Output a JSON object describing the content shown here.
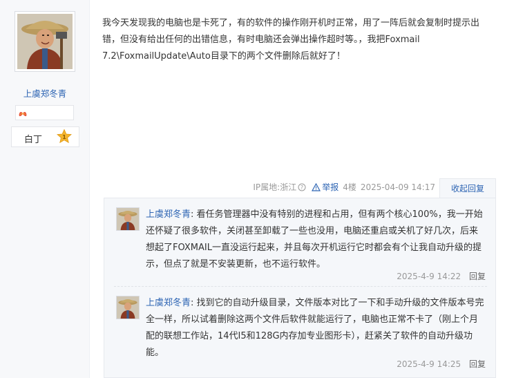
{
  "author": {
    "username": "上虞郑冬青",
    "rank": "白丁",
    "rank_badge": "1"
  },
  "post": {
    "body": "我今天发现我的电脑也是卡死了，有的软件的操作刚开机时正常，用了一阵后就会复制时提示出错，但没有给出任何的出错信息，有时电脑还会弹出操作超时等。，我把Foxmail 7.2\\FoxmailUpdate\\Auto目录下的两个文件删除后就好了！",
    "ip_location": "IP属地:浙江",
    "report_label": "举报",
    "floor": "4楼",
    "timestamp": "2025-04-09 14:17",
    "collapse_label": "收起回复"
  },
  "replies": [
    {
      "username": "上虞郑冬青",
      "separator": ":",
      "text": " 看任务管理器中没有特别的进程和占用，但有两个核心100%，我一开始还怀疑了很多软件，关闭甚至卸载了一些也没用，电脑还重启或关机了好几次，后来想起了FOXMAIL一直没运行起来，并且每次开机运行它时都会有个让我自动升级的提示，但点了就是不安装更新，也不运行软件。",
      "time": "2025-4-9 14:22",
      "reply_label": "回复"
    },
    {
      "username": "上虞郑冬青",
      "separator": ":",
      "text": " 找到它的自动升级目录，文件版本对比了一下和手动升级的文件版本号完全一样，所以试着删除这两个文件后软件就能运行了，电脑也正常不卡了（刚上个月配的联想工作站，14代I5和128G内存加专业图形卡），赶紧关了软件的自动升级功能。",
      "time": "2025-4-9 14:25",
      "reply_label": "回复"
    }
  ],
  "icons": {
    "level": "lungs-level-icon",
    "rank_badge": "star-badge-icon",
    "help": "help-circle-icon",
    "report": "warning-triangle-icon"
  },
  "colors": {
    "link": "#2d64b3",
    "meta": "#999999",
    "sidebar_bg": "#f7f8fa",
    "reply_bg": "#f5f7fa",
    "badge": "#f5b52e"
  }
}
